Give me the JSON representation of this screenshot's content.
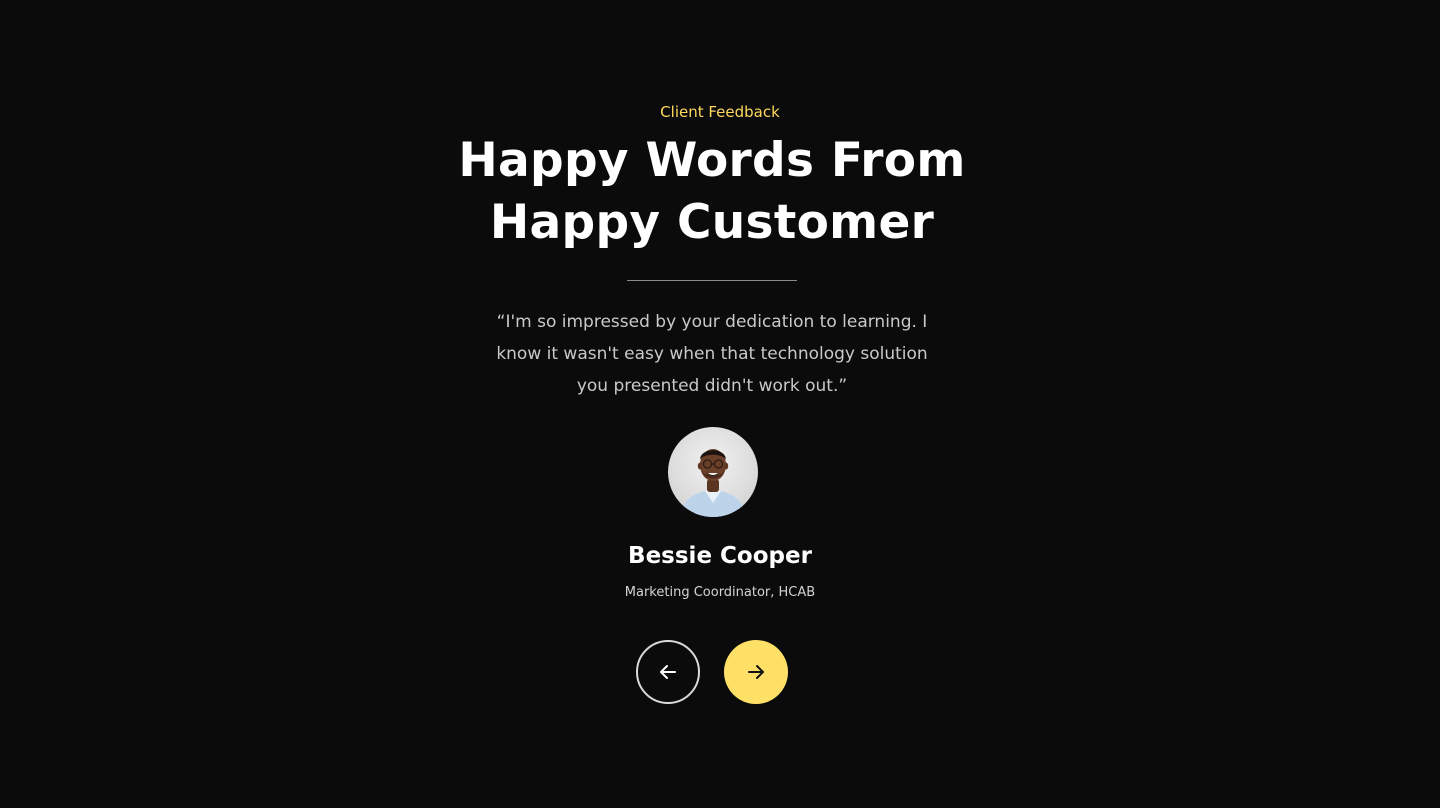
{
  "testimonial": {
    "eyebrow": "Client Feedback",
    "title_line1": "Happy Words From",
    "title_line2": "Happy Customer",
    "quote": "“I'm so impressed by your dedication to learning. I know it wasn't easy when that technology solution you presented didn't work out.”",
    "author_name": "Bessie Cooper",
    "author_role": "Marketing Coordinator, HCAB"
  },
  "controls": {
    "prev_icon": "arrow-left-icon",
    "next_icon": "arrow-right-icon"
  },
  "colors": {
    "background": "#0b0b0b",
    "accent": "#ffd95e",
    "next_button": "#ffe066",
    "text_primary": "#ffffff",
    "text_muted": "#c9c9c9"
  }
}
